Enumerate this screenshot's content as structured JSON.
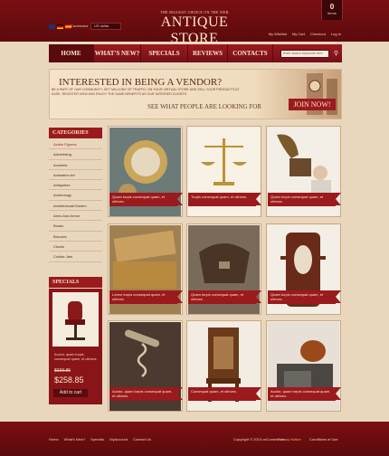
{
  "header": {
    "currency_label": "Currencies",
    "currency_value": "US dollar",
    "tagline": "THE BIGGEST CHOICE ON THE WEB",
    "logo": "ANTIQUE STORE",
    "cart_count": "0",
    "cart_items_label": "items",
    "links": [
      "My Wishlist",
      "My Cart",
      "Checkout",
      "Log In"
    ]
  },
  "nav": {
    "items": [
      "HOME",
      "WHAT'S NEW?",
      "SPECIALS",
      "REVIEWS",
      "CONTACTS"
    ],
    "search_placeholder": "Enter search keywords here"
  },
  "banner": {
    "title": "INTERESTED IN BEING A VENDOR?",
    "text": "BE A PART OF OUR COMMUNITY. GET MILLIONS OF TRAFFIC ON YOUR VIRTUAL STORE AND SELL YOUR PRODUCTS AT EASE. REGISTER NOW AND ENJOY THE SAME BENEFITS AS OUR SATISFIED CLIENTS.",
    "subtitle": "SEE WHAT PEOPLE ARE LOOKING FOR",
    "button": "JOIN NOW!"
  },
  "sidebar": {
    "categories_title": "CATEGORIES",
    "categories": [
      "Action Figures",
      "Advertising",
      "Ancients",
      "Animation Art",
      "Antiquities",
      "Archeology",
      "Architectural/Garden",
      "Arms And Armor",
      "Books",
      "Bronzes",
      "Clocks",
      "Cookie Jars"
    ],
    "specials_title": "SPECIALS",
    "special_desc": "Auctor, quam turpis consequat quam, et ultrices.",
    "special_old_price": "$339.85",
    "special_price": "$258.85",
    "add_to_cart": "Add to cart"
  },
  "products": [
    {
      "label": "Quam turpis consequat quam, et ultrices.",
      "icon": "coin-clock"
    },
    {
      "label": "Turpis consequat quam, et ultrices.",
      "icon": "scales"
    },
    {
      "label": "Quam turpis consequat quam, et ultrices.",
      "icon": "gramophone"
    },
    {
      "label": "Lorem turpis consequat quam, et ultrices.",
      "icon": "old-money"
    },
    {
      "label": "Quam turpis consequat quam, et ultrices.",
      "icon": "leather-bag"
    },
    {
      "label": "Quam turpis consequat quam, et ultrices.",
      "icon": "mirror-stand"
    },
    {
      "label": "Auctor, quam turpis consequat quam, et ultrices.",
      "icon": "corkscrew"
    },
    {
      "label": "Consequat quam, et ultrices.",
      "icon": "wooden-chair"
    },
    {
      "label": "Auctor, quam turpis consequat quam, et ultrices.",
      "icon": "kettle-stove"
    }
  ],
  "footer": {
    "links": [
      "Home",
      "What's New?",
      "Specials",
      "MyAccount",
      "Contact Us"
    ],
    "copyright": "Copyright © 2013 osCommerce",
    "privacy": "Privacy Notice",
    "conditions": "Conditions of Use"
  },
  "colors": {
    "primary": "#9b1a1d",
    "background": "#e9d7bd",
    "dark": "#5c0a0d"
  }
}
